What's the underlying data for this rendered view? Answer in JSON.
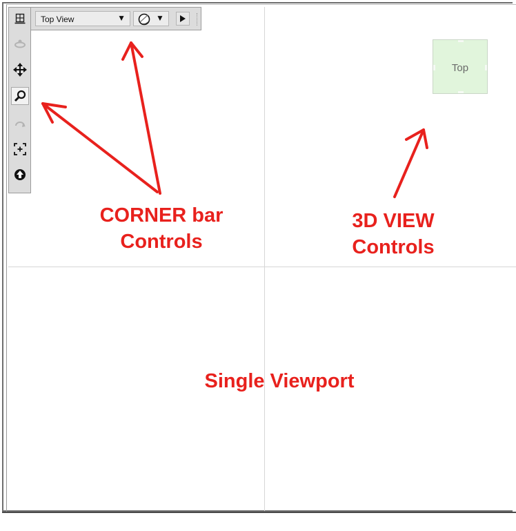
{
  "toolbar": {
    "view_selector": {
      "label": "Top View",
      "arrow": "▼"
    },
    "shading_button": {
      "icon": "shaded-sphere-icon",
      "arrow": "▼"
    },
    "play_button": {
      "icon": "play-icon"
    },
    "vertical_tools": [
      {
        "name": "layout-icon",
        "enabled": true
      },
      {
        "name": "orbit-icon",
        "enabled": false
      },
      {
        "name": "pan-icon",
        "enabled": true
      },
      {
        "name": "zoom-icon",
        "enabled": true
      },
      {
        "name": "undo-view-icon",
        "enabled": false
      },
      {
        "name": "zoom-extents-icon",
        "enabled": true
      },
      {
        "name": "up-arrow-icon",
        "enabled": true
      }
    ]
  },
  "viewcube": {
    "face_label": "Top",
    "color": "#e1f5dc"
  },
  "annotations": {
    "corner_bar_line1": "CORNER bar",
    "corner_bar_line2": "Controls",
    "view3d_line1": "3D VIEW",
    "view3d_line2": "Controls",
    "viewport": "Single Viewport",
    "color": "#e8211d"
  }
}
